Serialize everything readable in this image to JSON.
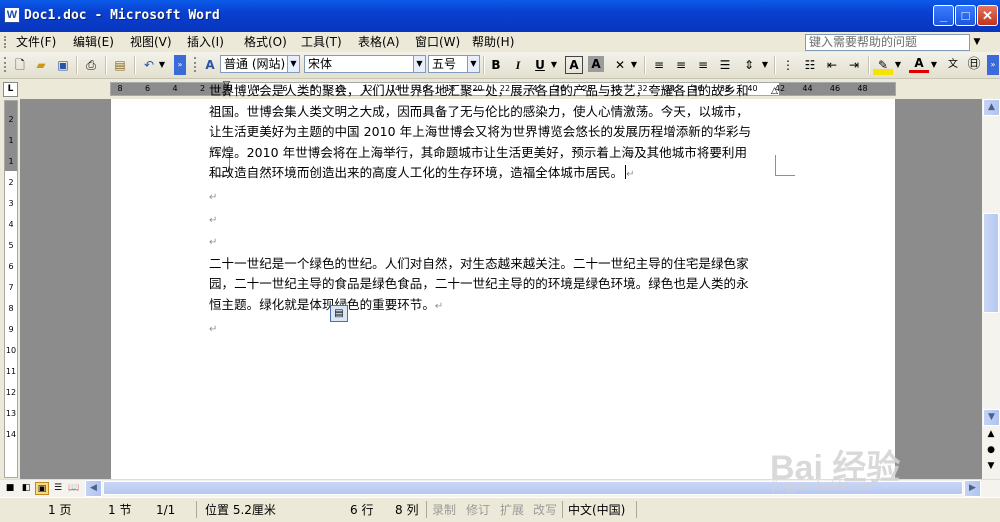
{
  "window": {
    "title": "Doc1.doc - Microsoft Word",
    "minimize_glyph": "_",
    "maximize_glyph": "□",
    "close_glyph": "✕"
  },
  "menu": {
    "items": [
      "文件(F)",
      "编辑(E)",
      "视图(V)",
      "插入(I)",
      "格式(O)",
      "工具(T)",
      "表格(A)",
      "窗口(W)",
      "帮助(H)"
    ],
    "help_placeholder": "键入需要帮助的问题"
  },
  "toolbar": {
    "style_value": "普通 (网站)",
    "font_value": "宋体",
    "size_value": "五号",
    "bold": "B",
    "italic": "I",
    "underline": "U",
    "char_border": "A",
    "char_shading": "A",
    "font_color": "A",
    "style_icon": "A"
  },
  "ruler": {
    "corner": "L",
    "numbers": [
      "8",
      "6",
      "4",
      "2",
      "2",
      "4",
      "6",
      "8",
      "10",
      "12",
      "14",
      "16",
      "18",
      "20",
      "22",
      "24",
      "26",
      "28",
      "30",
      "32",
      "34",
      "36",
      "38",
      "40",
      "42",
      "44",
      "46",
      "48"
    ],
    "vertical_numbers": [
      "2",
      "1",
      "1",
      "2",
      "3",
      "4",
      "5",
      "6",
      "7",
      "8",
      "9",
      "10",
      "11",
      "12",
      "13",
      "14"
    ]
  },
  "document": {
    "paragraph1": "世界博览会是人类的聚会，人们从世界各地汇聚一处，展示各自的产品与技艺，夸耀各自的故乡和祖国。世博会集人类文明之大成，因而具备了无与伦比的感染力，使人心情激荡。今天，以城市，让生活更美好为主题的中国 2010 年上海世博会又将为世界博览会悠长的发展历程增添新的华彩与辉煌。2010 年世博会将在上海举行，其命题城市让生活更美好，预示着上海及其他城市将要利用和改造自然环境而创造出来的高度人工化的生存环境，造福全体城市居民。",
    "paragraph2": "二十一世纪是一个绿色的世纪。人们对自然，对生态越来越关注。二十一世纪主导的住宅是绿色家园，二十一世纪主导的食品是绿色食品，二十一世纪主导的的环境是绿色环境。绿色也是人类的永恒主题。绿化就是体现绿色的重要环节。",
    "paragraph_mark": "↵"
  },
  "status": {
    "page": "1 页",
    "section": "1 节",
    "page_count": "1/1",
    "position": "位置 5.2厘米",
    "line": "6 行",
    "column": "8 列",
    "rec": "录制",
    "trk": "修订",
    "ext": "扩展",
    "ovr": "改写",
    "language": "中文(中国)"
  },
  "watermark": {
    "logo": "Bai 经验",
    "url": "jingyan.baidu.com"
  },
  "colors": {
    "titlebar": "#0a3fd0",
    "chrome": "#ece9d8",
    "doc_background": "#8c8c8c",
    "scrollbar": "#b6c8f1"
  }
}
